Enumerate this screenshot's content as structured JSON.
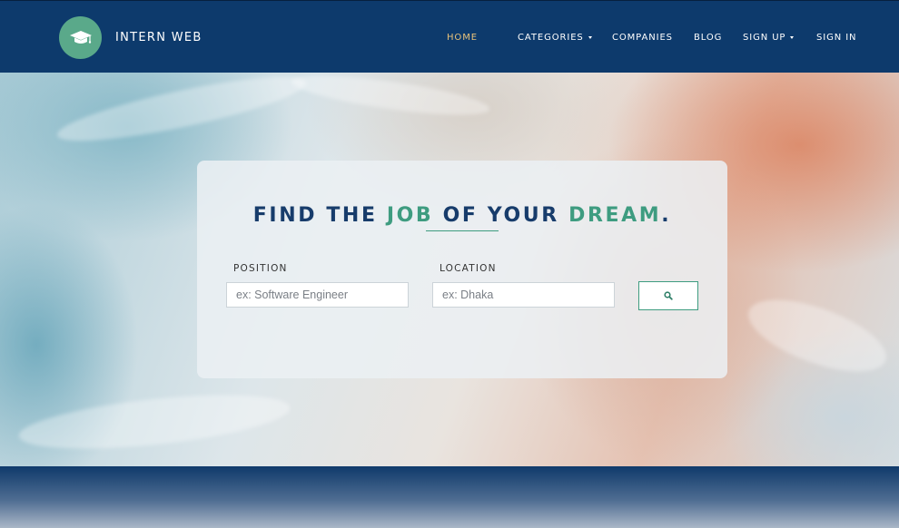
{
  "brand": {
    "name": "INTERN WEB",
    "logo_icon": "graduation-cap-icon",
    "logo_color": "#5aa98a"
  },
  "nav": {
    "items": [
      {
        "label": "HOME",
        "active": true,
        "dropdown": false
      },
      {
        "label": "CATEGORIES",
        "active": false,
        "dropdown": true
      },
      {
        "label": "COMPANIES",
        "active": false,
        "dropdown": false
      },
      {
        "label": "BLOG",
        "active": false,
        "dropdown": false
      },
      {
        "label": "SIGN UP",
        "active": false,
        "dropdown": true
      },
      {
        "label": "SIGN IN",
        "active": false,
        "dropdown": false
      }
    ]
  },
  "hero": {
    "headline": {
      "part1": "FIND THE ",
      "accent1": "JOB",
      "part2": " OF YOUR ",
      "accent2": "DREAM",
      "part3": "."
    },
    "search": {
      "position_label": "POSITION",
      "position_placeholder": "ex: Software Engineer",
      "position_value": "",
      "location_label": "LOCATION",
      "location_placeholder": "ex: Dhaka",
      "location_value": "",
      "button_icon": "search-icon"
    }
  },
  "colors": {
    "navbar": "#0d3a6c",
    "accent_green": "#3e9c80",
    "headline_navy": "#173c6b",
    "active_nav": "#e8c27a"
  }
}
